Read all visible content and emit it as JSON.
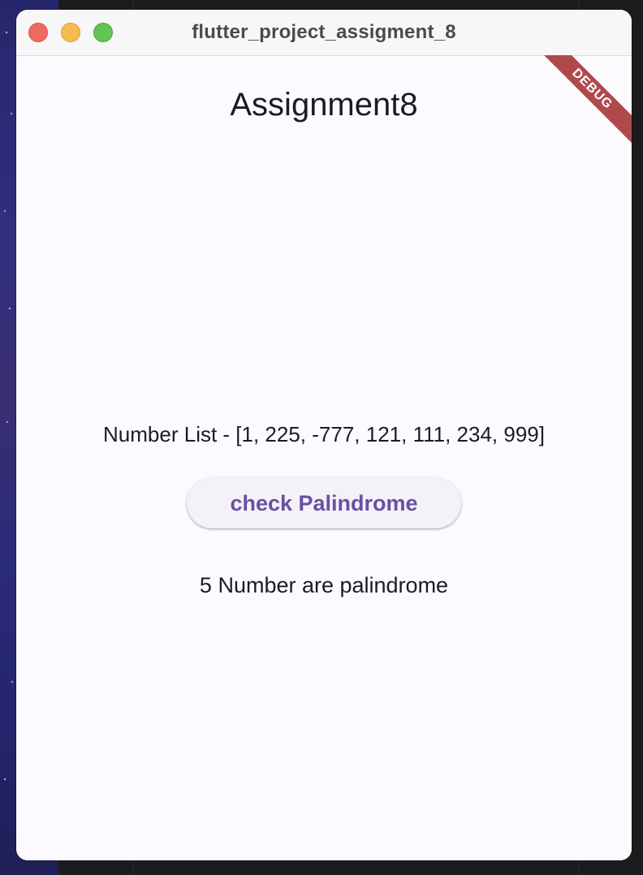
{
  "window": {
    "title": "flutter_project_assigment_8"
  },
  "app": {
    "title": "Assignment8",
    "number_list_text": "Number List - [1, 225, -777, 121, 111, 234, 999]",
    "check_button_label": "check Palindrome",
    "result_text": "5 Number are palindrome",
    "debug_banner": "DEBUG"
  },
  "colors": {
    "accent": "#6750a4",
    "background": "#fcfaff",
    "debug_banner": "#b04a4a",
    "traffic_close": "#ee6a5f",
    "traffic_minimize": "#f5bd4f",
    "traffic_zoom": "#61c554"
  }
}
